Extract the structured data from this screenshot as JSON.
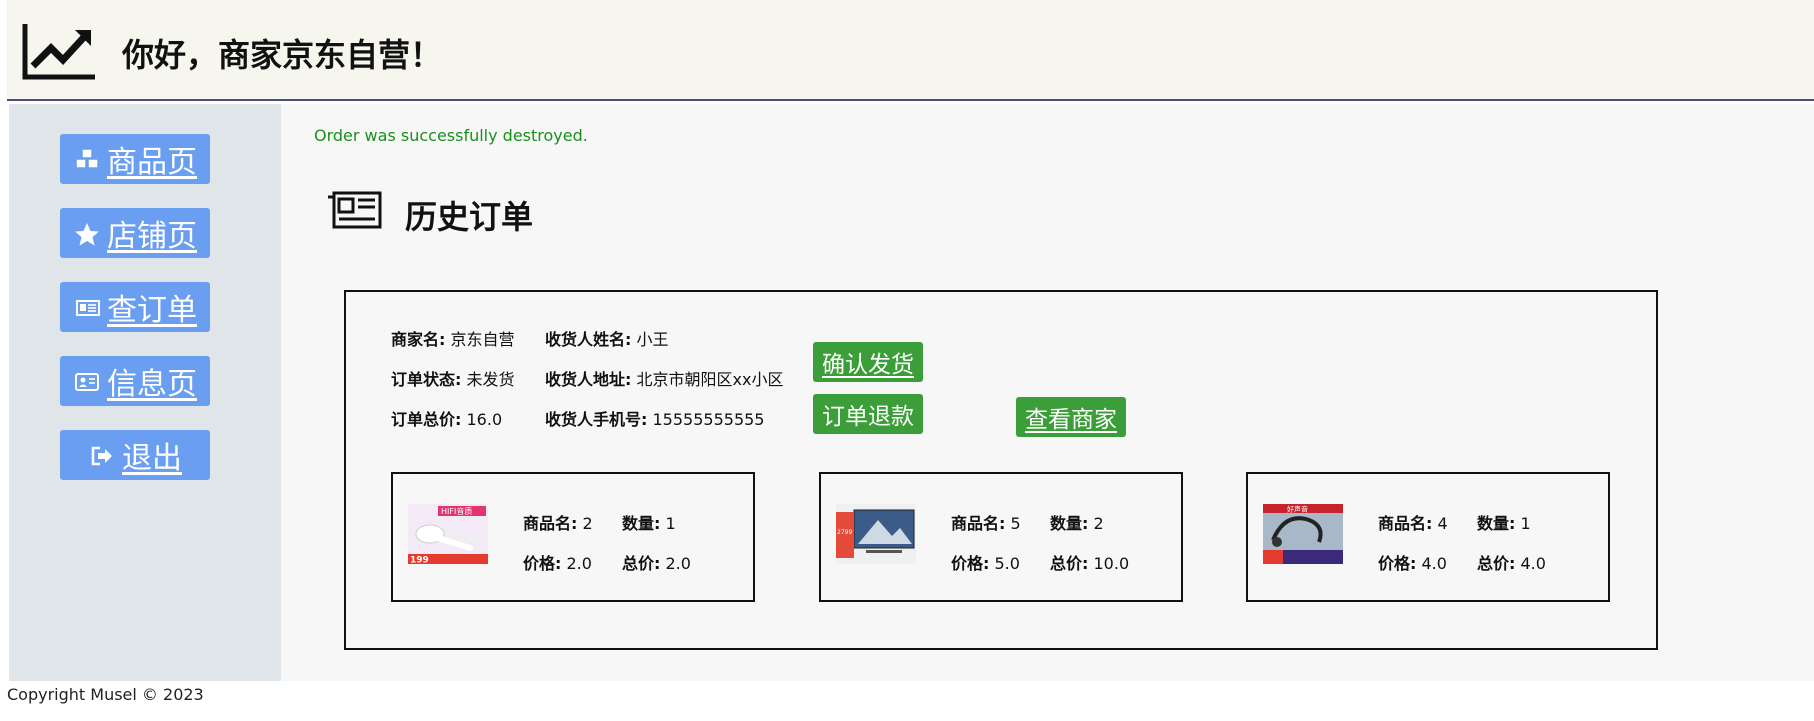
{
  "header": {
    "title": "你好，商家京东自营！",
    "icon": "chart-line-icon"
  },
  "sidebar": {
    "items": [
      {
        "label": "商品页",
        "icon": "cubes-icon"
      },
      {
        "label": "店铺页",
        "icon": "star-icon"
      },
      {
        "label": "查订单",
        "icon": "newspaper-icon"
      },
      {
        "label": "信息页",
        "icon": "id-card-icon"
      },
      {
        "label": "退出",
        "icon": "sign-out-icon"
      }
    ]
  },
  "main": {
    "notice": "Order was successfully destroyed.",
    "section_title": "历史订单",
    "section_icon": "newspaper-icon"
  },
  "order": {
    "merchant_label": "商家名:",
    "merchant_value": "京东自营",
    "status_label": "订单状态:",
    "status_value": "未发货",
    "total_label": "订单总价:",
    "total_value": "16.0",
    "receiver_label": "收货人姓名:",
    "receiver_value": "小王",
    "address_label": "收货人地址:",
    "address_value": "北京市朝阳区xx小区",
    "phone_label": "收货人手机号:",
    "phone_value": "15555555555",
    "confirm_button": "确认发货",
    "refund_button": "订单退款",
    "view_merchant_button": "查看商家",
    "items": [
      {
        "name_label": "商品名:",
        "name": "2",
        "qty_label": "数量:",
        "qty": "1",
        "price_label": "价格:",
        "price": "2.0",
        "subtotal_label": "总价:",
        "subtotal": "2.0",
        "thumb_text": "HIFI音质",
        "thumb_price": "199"
      },
      {
        "name_label": "商品名:",
        "name": "5",
        "qty_label": "数量:",
        "qty": "2",
        "price_label": "价格:",
        "price": "5.0",
        "subtotal_label": "总价:",
        "subtotal": "10.0",
        "thumb_text": "",
        "thumb_price": "2799"
      },
      {
        "name_label": "商品名:",
        "name": "4",
        "qty_label": "数量:",
        "qty": "1",
        "price_label": "价格:",
        "price": "4.0",
        "subtotal_label": "总价:",
        "subtotal": "4.0",
        "thumb_text": "好声音",
        "thumb_price": ""
      }
    ]
  },
  "footer": {
    "copyright": "Copyright Musel © 2023"
  },
  "colors": {
    "header_bg": "#f6f5ee",
    "header_border": "#4a4d79",
    "sidebar_bg": "#dfe5e9",
    "nav_button": "#6a9ef1",
    "green_button": "#3b9e38",
    "notice_text": "#1b8f1b"
  }
}
